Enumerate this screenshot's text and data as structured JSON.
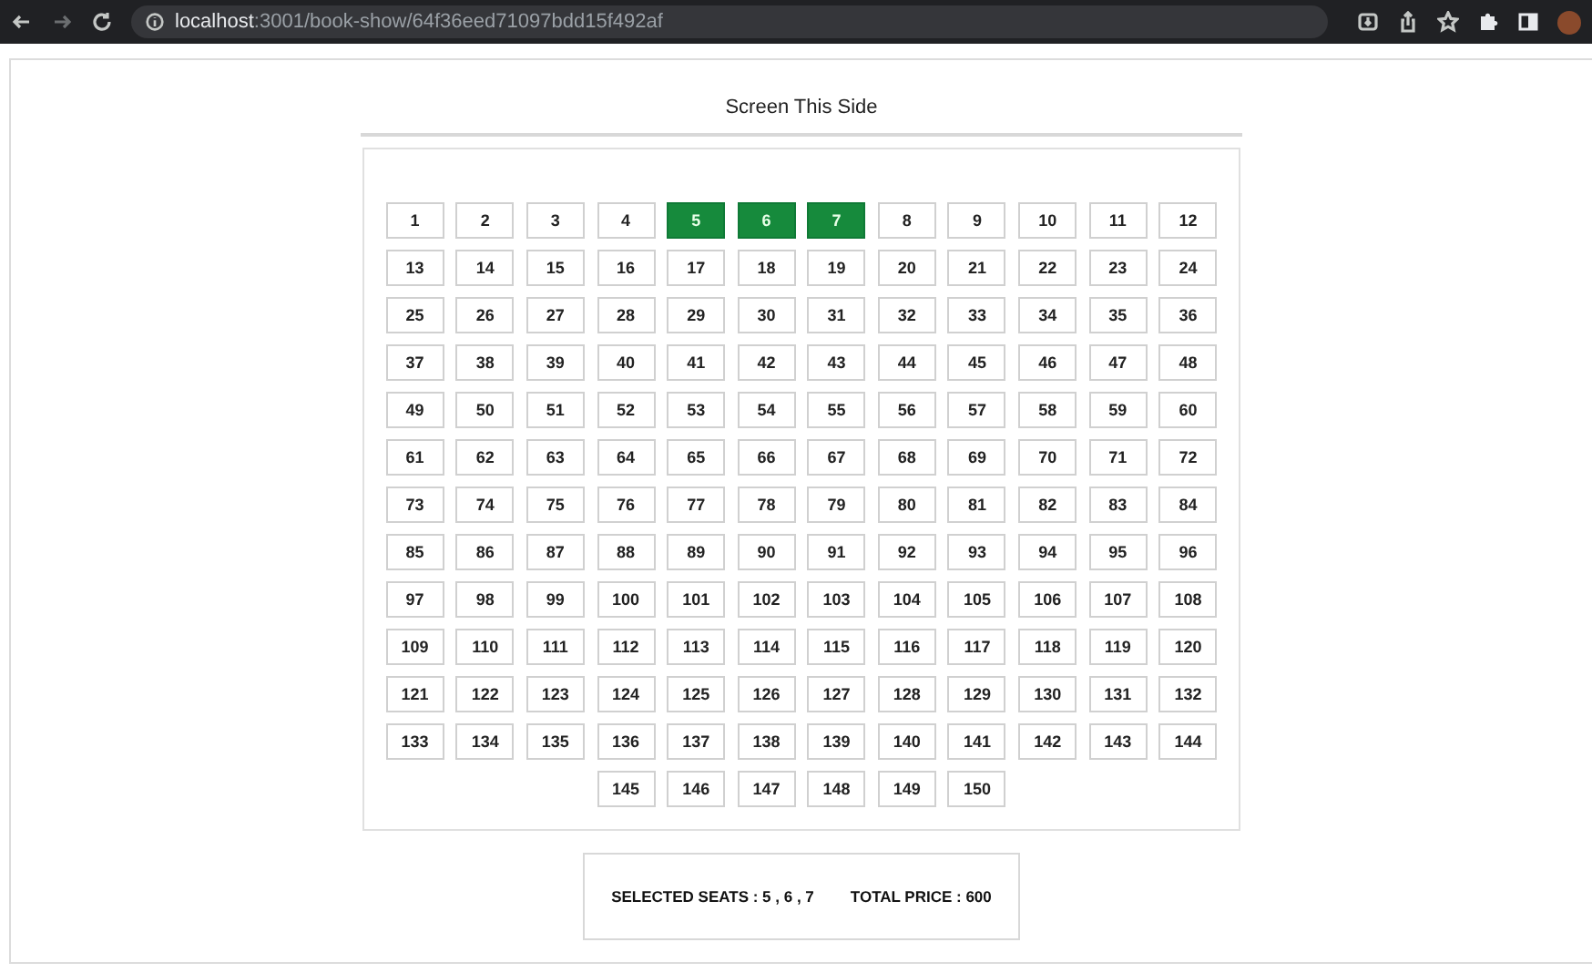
{
  "browser": {
    "url_host": "localhost",
    "url_path": ":3001/book-show/64f36eed71097bdd15f492af"
  },
  "screen_label": "Screen This Side",
  "seats": [
    {
      "label": "1",
      "selected": false
    },
    {
      "label": "2",
      "selected": false
    },
    {
      "label": "3",
      "selected": false
    },
    {
      "label": "4",
      "selected": false
    },
    {
      "label": "5",
      "selected": true
    },
    {
      "label": "6",
      "selected": true
    },
    {
      "label": "7",
      "selected": true
    },
    {
      "label": "8",
      "selected": false
    },
    {
      "label": "9",
      "selected": false
    },
    {
      "label": "10",
      "selected": false
    },
    {
      "label": "11",
      "selected": false
    },
    {
      "label": "12",
      "selected": false
    },
    {
      "label": "13",
      "selected": false
    },
    {
      "label": "14",
      "selected": false
    },
    {
      "label": "15",
      "selected": false
    },
    {
      "label": "16",
      "selected": false
    },
    {
      "label": "17",
      "selected": false
    },
    {
      "label": "18",
      "selected": false
    },
    {
      "label": "19",
      "selected": false
    },
    {
      "label": "20",
      "selected": false
    },
    {
      "label": "21",
      "selected": false
    },
    {
      "label": "22",
      "selected": false
    },
    {
      "label": "23",
      "selected": false
    },
    {
      "label": "24",
      "selected": false
    },
    {
      "label": "25",
      "selected": false
    },
    {
      "label": "26",
      "selected": false
    },
    {
      "label": "27",
      "selected": false
    },
    {
      "label": "28",
      "selected": false
    },
    {
      "label": "29",
      "selected": false
    },
    {
      "label": "30",
      "selected": false
    },
    {
      "label": "31",
      "selected": false
    },
    {
      "label": "32",
      "selected": false
    },
    {
      "label": "33",
      "selected": false
    },
    {
      "label": "34",
      "selected": false
    },
    {
      "label": "35",
      "selected": false
    },
    {
      "label": "36",
      "selected": false
    },
    {
      "label": "37",
      "selected": false
    },
    {
      "label": "38",
      "selected": false
    },
    {
      "label": "39",
      "selected": false
    },
    {
      "label": "40",
      "selected": false
    },
    {
      "label": "41",
      "selected": false
    },
    {
      "label": "42",
      "selected": false
    },
    {
      "label": "43",
      "selected": false
    },
    {
      "label": "44",
      "selected": false
    },
    {
      "label": "45",
      "selected": false
    },
    {
      "label": "46",
      "selected": false
    },
    {
      "label": "47",
      "selected": false
    },
    {
      "label": "48",
      "selected": false
    },
    {
      "label": "49",
      "selected": false
    },
    {
      "label": "50",
      "selected": false
    },
    {
      "label": "51",
      "selected": false
    },
    {
      "label": "52",
      "selected": false
    },
    {
      "label": "53",
      "selected": false
    },
    {
      "label": "54",
      "selected": false
    },
    {
      "label": "55",
      "selected": false
    },
    {
      "label": "56",
      "selected": false
    },
    {
      "label": "57",
      "selected": false
    },
    {
      "label": "58",
      "selected": false
    },
    {
      "label": "59",
      "selected": false
    },
    {
      "label": "60",
      "selected": false
    },
    {
      "label": "61",
      "selected": false
    },
    {
      "label": "62",
      "selected": false
    },
    {
      "label": "63",
      "selected": false
    },
    {
      "label": "64",
      "selected": false
    },
    {
      "label": "65",
      "selected": false
    },
    {
      "label": "66",
      "selected": false
    },
    {
      "label": "67",
      "selected": false
    },
    {
      "label": "68",
      "selected": false
    },
    {
      "label": "69",
      "selected": false
    },
    {
      "label": "70",
      "selected": false
    },
    {
      "label": "71",
      "selected": false
    },
    {
      "label": "72",
      "selected": false
    },
    {
      "label": "73",
      "selected": false
    },
    {
      "label": "74",
      "selected": false
    },
    {
      "label": "75",
      "selected": false
    },
    {
      "label": "76",
      "selected": false
    },
    {
      "label": "77",
      "selected": false
    },
    {
      "label": "78",
      "selected": false
    },
    {
      "label": "79",
      "selected": false
    },
    {
      "label": "80",
      "selected": false
    },
    {
      "label": "81",
      "selected": false
    },
    {
      "label": "82",
      "selected": false
    },
    {
      "label": "83",
      "selected": false
    },
    {
      "label": "84",
      "selected": false
    },
    {
      "label": "85",
      "selected": false
    },
    {
      "label": "86",
      "selected": false
    },
    {
      "label": "87",
      "selected": false
    },
    {
      "label": "88",
      "selected": false
    },
    {
      "label": "89",
      "selected": false
    },
    {
      "label": "90",
      "selected": false
    },
    {
      "label": "91",
      "selected": false
    },
    {
      "label": "92",
      "selected": false
    },
    {
      "label": "93",
      "selected": false
    },
    {
      "label": "94",
      "selected": false
    },
    {
      "label": "95",
      "selected": false
    },
    {
      "label": "96",
      "selected": false
    },
    {
      "label": "97",
      "selected": false
    },
    {
      "label": "98",
      "selected": false
    },
    {
      "label": "99",
      "selected": false
    },
    {
      "label": "100",
      "selected": false
    },
    {
      "label": "101",
      "selected": false
    },
    {
      "label": "102",
      "selected": false
    },
    {
      "label": "103",
      "selected": false
    },
    {
      "label": "104",
      "selected": false
    },
    {
      "label": "105",
      "selected": false
    },
    {
      "label": "106",
      "selected": false
    },
    {
      "label": "107",
      "selected": false
    },
    {
      "label": "108",
      "selected": false
    },
    {
      "label": "109",
      "selected": false
    },
    {
      "label": "110",
      "selected": false
    },
    {
      "label": "111",
      "selected": false
    },
    {
      "label": "112",
      "selected": false
    },
    {
      "label": "113",
      "selected": false
    },
    {
      "label": "114",
      "selected": false
    },
    {
      "label": "115",
      "selected": false
    },
    {
      "label": "116",
      "selected": false
    },
    {
      "label": "117",
      "selected": false
    },
    {
      "label": "118",
      "selected": false
    },
    {
      "label": "119",
      "selected": false
    },
    {
      "label": "120",
      "selected": false
    },
    {
      "label": "121",
      "selected": false
    },
    {
      "label": "122",
      "selected": false
    },
    {
      "label": "123",
      "selected": false
    },
    {
      "label": "124",
      "selected": false
    },
    {
      "label": "125",
      "selected": false
    },
    {
      "label": "126",
      "selected": false
    },
    {
      "label": "127",
      "selected": false
    },
    {
      "label": "128",
      "selected": false
    },
    {
      "label": "129",
      "selected": false
    },
    {
      "label": "130",
      "selected": false
    },
    {
      "label": "131",
      "selected": false
    },
    {
      "label": "132",
      "selected": false
    },
    {
      "label": "133",
      "selected": false
    },
    {
      "label": "134",
      "selected": false
    },
    {
      "label": "135",
      "selected": false
    },
    {
      "label": "136",
      "selected": false
    },
    {
      "label": "137",
      "selected": false
    },
    {
      "label": "138",
      "selected": false
    },
    {
      "label": "139",
      "selected": false
    },
    {
      "label": "140",
      "selected": false
    },
    {
      "label": "141",
      "selected": false
    },
    {
      "label": "142",
      "selected": false
    },
    {
      "label": "143",
      "selected": false
    },
    {
      "label": "144",
      "selected": false
    },
    {
      "label": "145",
      "selected": false
    },
    {
      "label": "146",
      "selected": false
    },
    {
      "label": "147",
      "selected": false
    },
    {
      "label": "148",
      "selected": false
    },
    {
      "label": "149",
      "selected": false
    },
    {
      "label": "150",
      "selected": false
    }
  ],
  "summary": {
    "selected_seats": "SELECTED SEATS : 5 , 6 , 7",
    "total_price": "TOTAL PRICE : 600"
  }
}
